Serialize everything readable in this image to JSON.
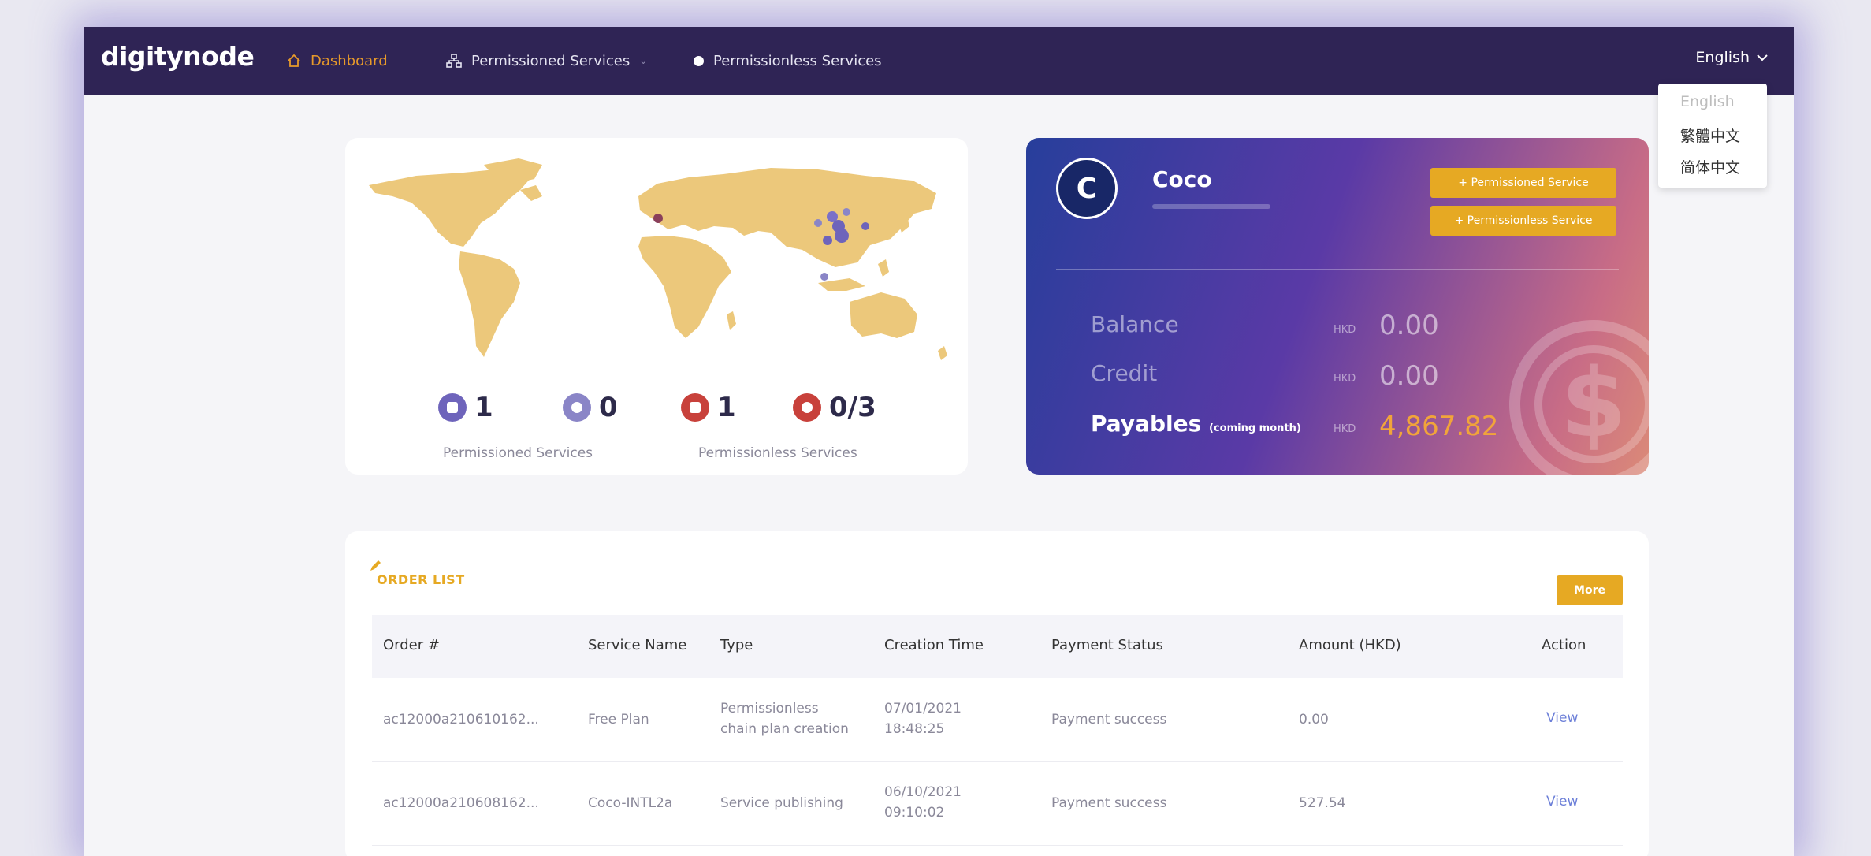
{
  "nav": {
    "logo": "digitynode",
    "items": [
      {
        "label": "Dashboard",
        "icon": "home-icon",
        "active": true
      },
      {
        "label": "Permissioned Services",
        "icon": "network-icon",
        "active": false
      },
      {
        "label": "Permissionless Services",
        "icon": "dot-icon",
        "active": false
      }
    ],
    "language": "English"
  },
  "language_menu": {
    "options": [
      "English",
      "繁體中文",
      "简体中文"
    ],
    "selected": "English"
  },
  "stats": {
    "items": [
      {
        "value": "1",
        "color": "#6e64bb",
        "icon": "server-icon"
      },
      {
        "value": "0",
        "color": "#8a85c7",
        "icon": "server-icon"
      },
      {
        "value": "1",
        "color": "#c8413b",
        "icon": "node-icon"
      },
      {
        "value": "0/3",
        "color": "#c8413b",
        "icon": "node-icon"
      }
    ],
    "captions": [
      "Permissioned Services",
      "Permissionless Services"
    ]
  },
  "profile": {
    "initial": "C",
    "name": "Coco",
    "buttons": [
      "+ Permissioned Service",
      "+ Permissionless Service"
    ],
    "balance_label": "Balance",
    "balance_currency": "HKD",
    "balance_value": "0.00",
    "credit_label": "Credit",
    "credit_currency": "HKD",
    "credit_value": "0.00",
    "payables_label": "Payables",
    "payables_note": "(coming month)",
    "payables_currency": "HKD",
    "payables_value": "4,867.82"
  },
  "orders": {
    "title": "ORDER LIST",
    "more_label": "More",
    "headers": [
      "Order #",
      "Service Name",
      "Type",
      "Creation Time",
      "Payment Status",
      "Amount (HKD)",
      "Action"
    ],
    "rows": [
      {
        "order": "ac12000a210610162...",
        "service": "Free Plan",
        "type1": "Permissionless",
        "type2": "chain plan creation",
        "date": "07/01/2021",
        "time": "18:48:25",
        "status": "Payment success",
        "amount": "0.00",
        "action": "View"
      },
      {
        "order": "ac12000a210608162...",
        "service": "Coco-INTL2a",
        "type1": "Service publishing",
        "type2": "",
        "date": "06/10/2021",
        "time": "09:10:02",
        "status": "Payment success",
        "amount": "527.54",
        "action": "View"
      }
    ]
  },
  "colors": {
    "nav": "#2f2455",
    "accent": "#e6a923",
    "active_nav": "#e89a2a",
    "map_land": "#ecc87b"
  }
}
